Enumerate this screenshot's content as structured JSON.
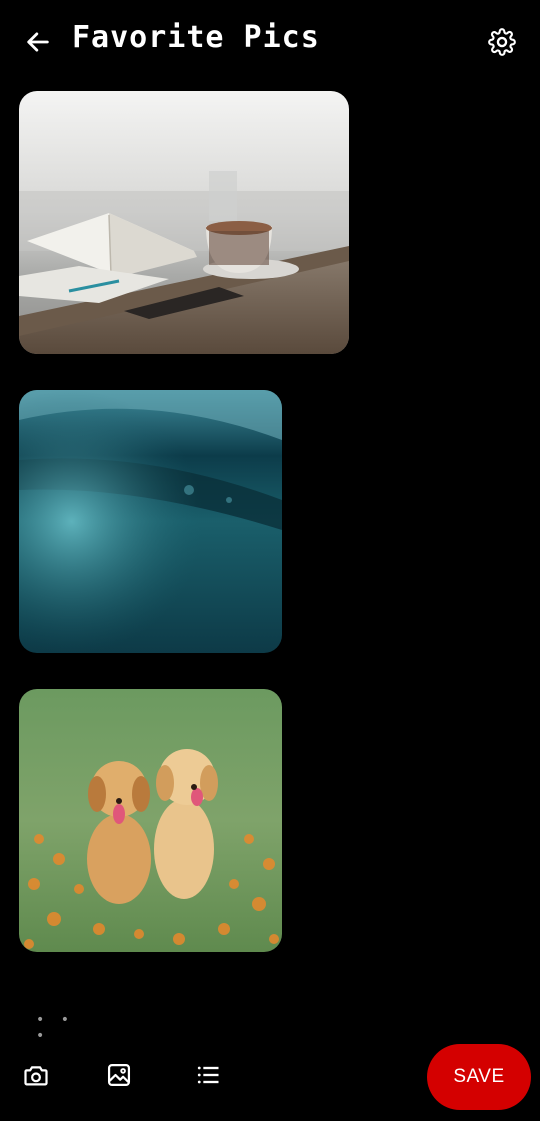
{
  "header": {
    "title": "Favorite Pics",
    "back_icon": "arrow-left-icon",
    "settings_icon": "gear-icon"
  },
  "photos": [
    {
      "subject": "coffee cup and notebooks on a desk"
    },
    {
      "subject": "underwater ocean wave"
    },
    {
      "subject": "two golden retriever puppies in a flower field"
    }
  ],
  "more_label": "• • •",
  "toolbar": {
    "camera_icon": "camera-icon",
    "gallery_icon": "image-icon",
    "list_icon": "list-icon",
    "save_label": "SAVE"
  },
  "colors": {
    "background": "#000000",
    "save_button": "#d40000",
    "text": "#ffffff"
  }
}
